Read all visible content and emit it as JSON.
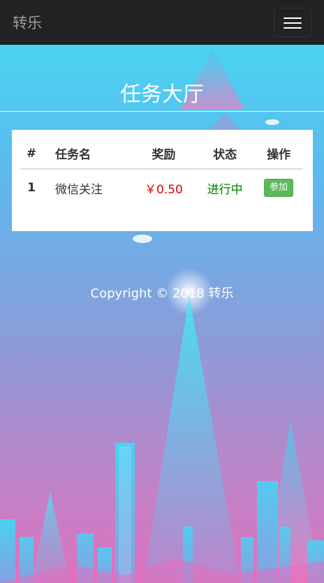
{
  "navbar": {
    "brand": "转乐",
    "toggle_icon": "hamburger-menu-icon"
  },
  "page": {
    "title": "任务大厅"
  },
  "table": {
    "headers": [
      "#",
      "任务名",
      "奖励",
      "状态",
      "操作"
    ],
    "rows": [
      {
        "num": "1",
        "name": "微信关注",
        "reward": "￥0.50",
        "status": "进行中",
        "action": "参加"
      }
    ]
  },
  "footer": {
    "copyright": "Copyright © 2018 转乐"
  },
  "colors": {
    "navbar_bg": "#222222",
    "reward": "#ee0000",
    "status": "#008000",
    "join_button": "#5cb85c"
  }
}
